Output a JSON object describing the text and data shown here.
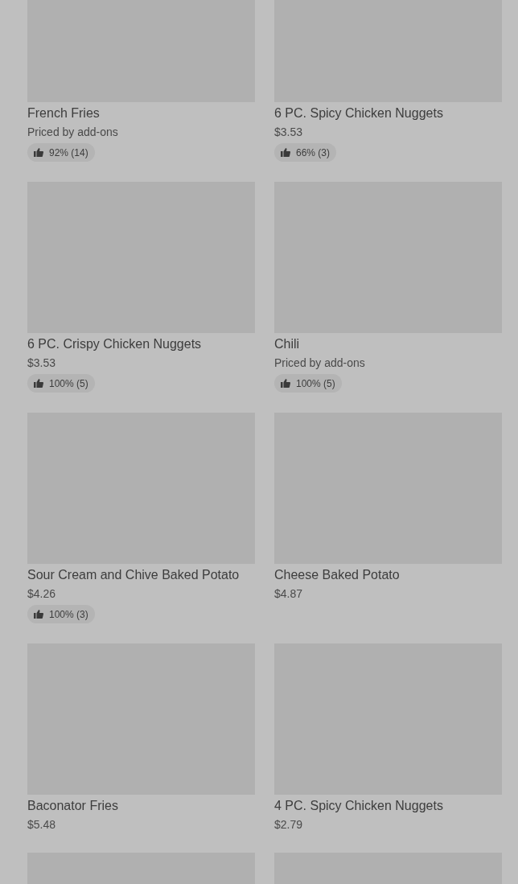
{
  "items": [
    {
      "kind": "full",
      "name": "French Fries",
      "price": "Priced by add-ons",
      "rating": "92% (14)"
    },
    {
      "kind": "full",
      "name": "6 PC. Spicy Chicken Nuggets",
      "price": "$3.53",
      "rating": "66% (3)"
    },
    {
      "kind": "full",
      "name": "6 PC. Crispy Chicken Nuggets",
      "price": "$3.53",
      "rating": "100% (5)"
    },
    {
      "kind": "full",
      "name": "Chili",
      "price": "Priced by add-ons",
      "rating": "100% (5)"
    },
    {
      "kind": "full",
      "name": "Sour Cream and Chive Baked Potato",
      "price": "$4.26",
      "rating": "100% (3)"
    },
    {
      "kind": "full",
      "name": "Cheese Baked Potato",
      "price": "$4.87"
    },
    {
      "kind": "full",
      "name": "Baconator Fries",
      "price": "$5.48"
    },
    {
      "kind": "full",
      "name": "4 PC. Spicy Chicken Nuggets",
      "price": "$2.79"
    },
    {
      "kind": "image_only"
    },
    {
      "kind": "image_only"
    }
  ]
}
